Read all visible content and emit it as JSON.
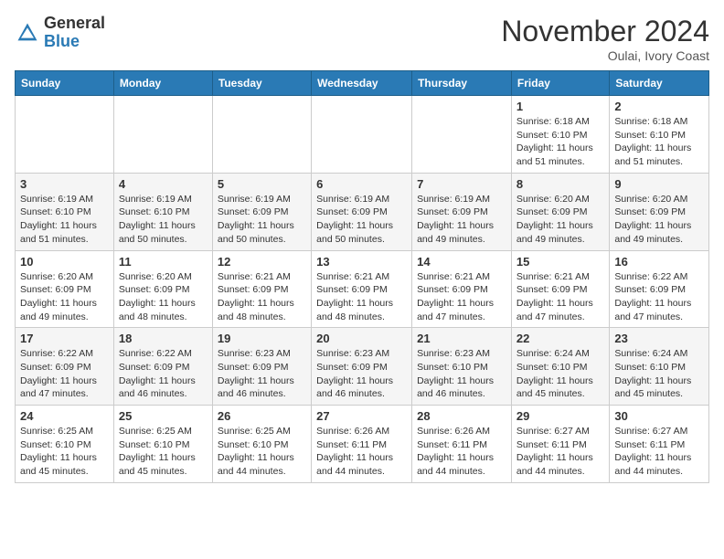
{
  "logo": {
    "general": "General",
    "blue": "Blue"
  },
  "header": {
    "month_year": "November 2024",
    "location": "Oulai, Ivory Coast"
  },
  "days_of_week": [
    "Sunday",
    "Monday",
    "Tuesday",
    "Wednesday",
    "Thursday",
    "Friday",
    "Saturday"
  ],
  "weeks": [
    [
      {
        "day": "",
        "info": ""
      },
      {
        "day": "",
        "info": ""
      },
      {
        "day": "",
        "info": ""
      },
      {
        "day": "",
        "info": ""
      },
      {
        "day": "",
        "info": ""
      },
      {
        "day": "1",
        "info": "Sunrise: 6:18 AM\nSunset: 6:10 PM\nDaylight: 11 hours and 51 minutes."
      },
      {
        "day": "2",
        "info": "Sunrise: 6:18 AM\nSunset: 6:10 PM\nDaylight: 11 hours and 51 minutes."
      }
    ],
    [
      {
        "day": "3",
        "info": "Sunrise: 6:19 AM\nSunset: 6:10 PM\nDaylight: 11 hours and 51 minutes."
      },
      {
        "day": "4",
        "info": "Sunrise: 6:19 AM\nSunset: 6:10 PM\nDaylight: 11 hours and 50 minutes."
      },
      {
        "day": "5",
        "info": "Sunrise: 6:19 AM\nSunset: 6:09 PM\nDaylight: 11 hours and 50 minutes."
      },
      {
        "day": "6",
        "info": "Sunrise: 6:19 AM\nSunset: 6:09 PM\nDaylight: 11 hours and 50 minutes."
      },
      {
        "day": "7",
        "info": "Sunrise: 6:19 AM\nSunset: 6:09 PM\nDaylight: 11 hours and 49 minutes."
      },
      {
        "day": "8",
        "info": "Sunrise: 6:20 AM\nSunset: 6:09 PM\nDaylight: 11 hours and 49 minutes."
      },
      {
        "day": "9",
        "info": "Sunrise: 6:20 AM\nSunset: 6:09 PM\nDaylight: 11 hours and 49 minutes."
      }
    ],
    [
      {
        "day": "10",
        "info": "Sunrise: 6:20 AM\nSunset: 6:09 PM\nDaylight: 11 hours and 49 minutes."
      },
      {
        "day": "11",
        "info": "Sunrise: 6:20 AM\nSunset: 6:09 PM\nDaylight: 11 hours and 48 minutes."
      },
      {
        "day": "12",
        "info": "Sunrise: 6:21 AM\nSunset: 6:09 PM\nDaylight: 11 hours and 48 minutes."
      },
      {
        "day": "13",
        "info": "Sunrise: 6:21 AM\nSunset: 6:09 PM\nDaylight: 11 hours and 48 minutes."
      },
      {
        "day": "14",
        "info": "Sunrise: 6:21 AM\nSunset: 6:09 PM\nDaylight: 11 hours and 47 minutes."
      },
      {
        "day": "15",
        "info": "Sunrise: 6:21 AM\nSunset: 6:09 PM\nDaylight: 11 hours and 47 minutes."
      },
      {
        "day": "16",
        "info": "Sunrise: 6:22 AM\nSunset: 6:09 PM\nDaylight: 11 hours and 47 minutes."
      }
    ],
    [
      {
        "day": "17",
        "info": "Sunrise: 6:22 AM\nSunset: 6:09 PM\nDaylight: 11 hours and 47 minutes."
      },
      {
        "day": "18",
        "info": "Sunrise: 6:22 AM\nSunset: 6:09 PM\nDaylight: 11 hours and 46 minutes."
      },
      {
        "day": "19",
        "info": "Sunrise: 6:23 AM\nSunset: 6:09 PM\nDaylight: 11 hours and 46 minutes."
      },
      {
        "day": "20",
        "info": "Sunrise: 6:23 AM\nSunset: 6:09 PM\nDaylight: 11 hours and 46 minutes."
      },
      {
        "day": "21",
        "info": "Sunrise: 6:23 AM\nSunset: 6:10 PM\nDaylight: 11 hours and 46 minutes."
      },
      {
        "day": "22",
        "info": "Sunrise: 6:24 AM\nSunset: 6:10 PM\nDaylight: 11 hours and 45 minutes."
      },
      {
        "day": "23",
        "info": "Sunrise: 6:24 AM\nSunset: 6:10 PM\nDaylight: 11 hours and 45 minutes."
      }
    ],
    [
      {
        "day": "24",
        "info": "Sunrise: 6:25 AM\nSunset: 6:10 PM\nDaylight: 11 hours and 45 minutes."
      },
      {
        "day": "25",
        "info": "Sunrise: 6:25 AM\nSunset: 6:10 PM\nDaylight: 11 hours and 45 minutes."
      },
      {
        "day": "26",
        "info": "Sunrise: 6:25 AM\nSunset: 6:10 PM\nDaylight: 11 hours and 44 minutes."
      },
      {
        "day": "27",
        "info": "Sunrise: 6:26 AM\nSunset: 6:11 PM\nDaylight: 11 hours and 44 minutes."
      },
      {
        "day": "28",
        "info": "Sunrise: 6:26 AM\nSunset: 6:11 PM\nDaylight: 11 hours and 44 minutes."
      },
      {
        "day": "29",
        "info": "Sunrise: 6:27 AM\nSunset: 6:11 PM\nDaylight: 11 hours and 44 minutes."
      },
      {
        "day": "30",
        "info": "Sunrise: 6:27 AM\nSunset: 6:11 PM\nDaylight: 11 hours and 44 minutes."
      }
    ]
  ]
}
